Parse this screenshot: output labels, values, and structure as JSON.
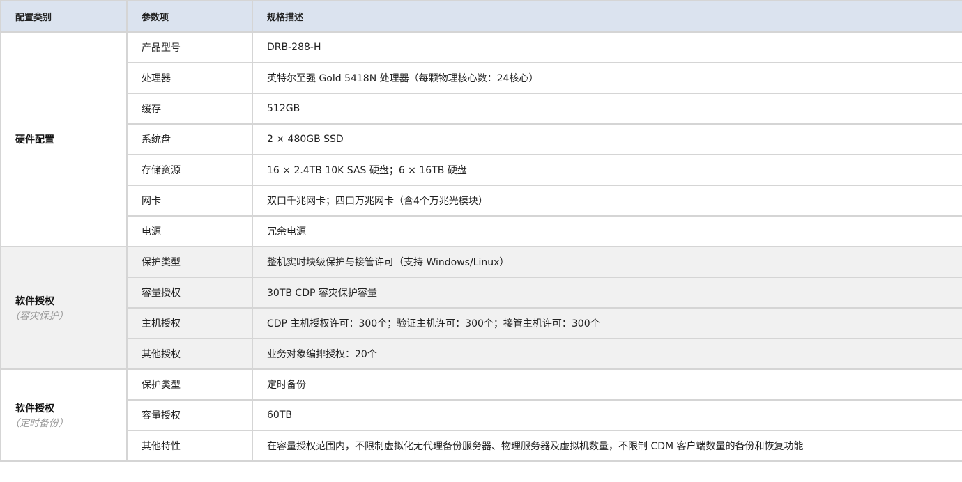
{
  "header": {
    "category": "配置类别",
    "param": "参数项",
    "spec": "规格描述"
  },
  "groups": [
    {
      "title": "硬件配置",
      "subtitle": "",
      "rows": [
        {
          "param": "产品型号",
          "spec": "DRB-288-H"
        },
        {
          "param": "处理器",
          "spec": "英特尔至强 Gold 5418N 处理器（每颗物理核心数：24核心）"
        },
        {
          "param": "缓存",
          "spec": "512GB"
        },
        {
          "param": "系统盘",
          "spec": "2 × 480GB SSD"
        },
        {
          "param": "存储资源",
          "spec": "16 × 2.4TB 10K SAS 硬盘；6 × 16TB 硬盘"
        },
        {
          "param": "网卡",
          "spec": "双口千兆网卡；四口万兆网卡（含4个万兆光模块）"
        },
        {
          "param": "电源",
          "spec": "冗余电源"
        }
      ]
    },
    {
      "title": "软件授权",
      "subtitle": "（容灾保护）",
      "rows": [
        {
          "param": "保护类型",
          "spec": "整机实时块级保护与接管许可（支持 Windows/Linux）"
        },
        {
          "param": "容量授权",
          "spec": "30TB CDP 容灾保护容量"
        },
        {
          "param": "主机授权",
          "spec": "CDP 主机授权许可：300个；验证主机许可：300个；接管主机许可：300个"
        },
        {
          "param": "其他授权",
          "spec": "业务对象编排授权：20个"
        }
      ]
    },
    {
      "title": "软件授权",
      "subtitle": "（定时备份）",
      "rows": [
        {
          "param": "保护类型",
          "spec": "定时备份"
        },
        {
          "param": "容量授权",
          "spec": "60TB"
        },
        {
          "param": "其他特性",
          "spec": "在容量授权范围内，不限制虚拟化无代理备份服务器、物理服务器及虚拟机数量，不限制 CDM 客户端数量的备份和恢复功能"
        }
      ]
    }
  ]
}
